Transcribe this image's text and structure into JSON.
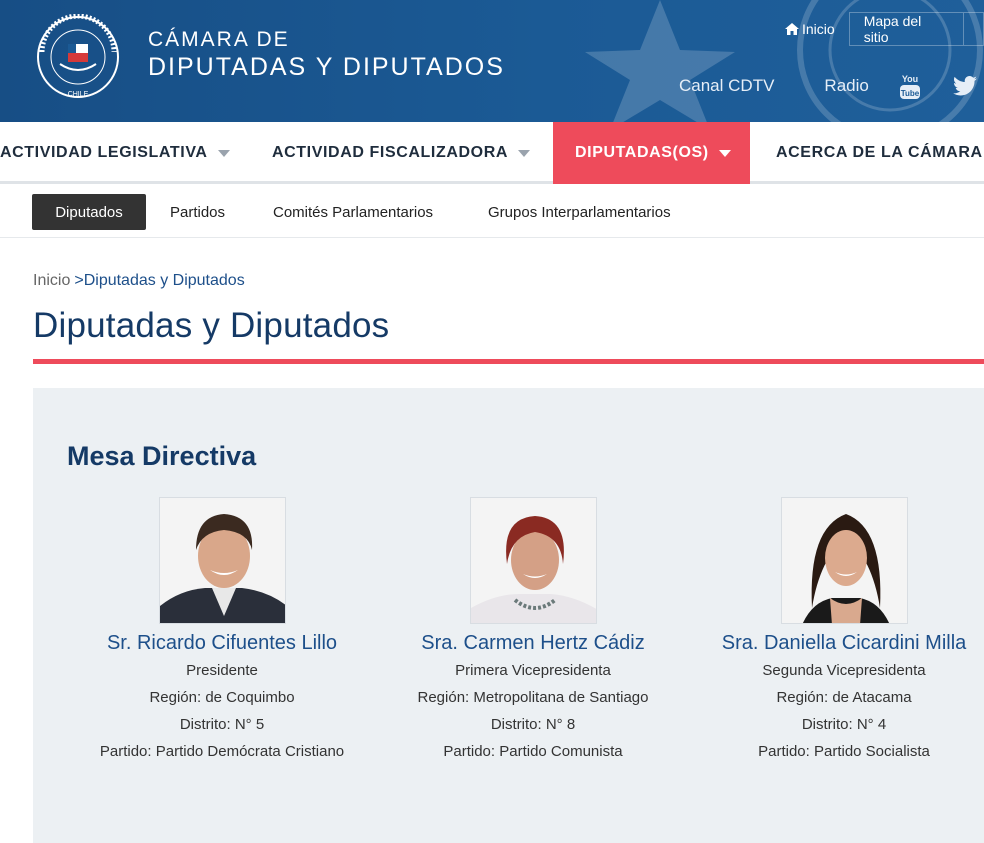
{
  "header": {
    "brand_line1": "CÁMARA DE",
    "brand_line2": "DIPUTADAS Y DIPUTADOS",
    "logo_text": "CÁMARA DE DIPUTADAS Y DIPUTADOS · CHILE",
    "top_links": {
      "home": "Inicio",
      "sitemap": "Mapa del sitio"
    },
    "media": {
      "tv": "Canal CDTV",
      "radio": "Radio",
      "youtube_icon": "youtube-icon",
      "twitter_icon": "twitter-icon"
    }
  },
  "main_nav": [
    {
      "label": "ACTIVIDAD LEGISLATIVA",
      "active": false
    },
    {
      "label": "ACTIVIDAD FISCALIZADORA",
      "active": false
    },
    {
      "label": "DIPUTADAS(OS)",
      "active": true
    },
    {
      "label": "ACERCA DE LA CÁMARA",
      "active": false
    }
  ],
  "sub_nav": [
    {
      "label": "Diputados",
      "active": true
    },
    {
      "label": "Partidos",
      "active": false
    },
    {
      "label": "Comités Parlamentarios",
      "active": false
    },
    {
      "label": "Grupos Interparlamentarios",
      "active": false
    }
  ],
  "breadcrumb": {
    "home": "Inicio",
    "separator": ">",
    "current": "Diputadas y Diputados"
  },
  "page_title": "Diputadas y Diputados",
  "section_title": "Mesa Directiva",
  "members": [
    {
      "name": "Sr. Ricardo Cifuentes Lillo",
      "role": "Presidente",
      "region": "Región: de Coquimbo",
      "district": "Distrito: N° 5",
      "party": "Partido: Partido Demócrata Cristiano"
    },
    {
      "name": "Sra. Carmen Hertz Cádiz",
      "role": "Primera Vicepresidenta",
      "region": "Región: Metropolitana de Santiago",
      "district": "Distrito: N° 8",
      "party": "Partido: Partido Comunista"
    },
    {
      "name": "Sra. Daniella Cicardini Milla",
      "role": "Segunda Vicepresidenta",
      "region": "Región: de Atacama",
      "district": "Distrito: N° 4",
      "party": "Partido: Partido Socialista"
    }
  ],
  "colors": {
    "header_bg": "#1b5a95",
    "accent_red": "#ee4b5b",
    "title_blue": "#153a66",
    "link_blue": "#1d4f8a",
    "panel_bg": "#ecf0f3"
  }
}
